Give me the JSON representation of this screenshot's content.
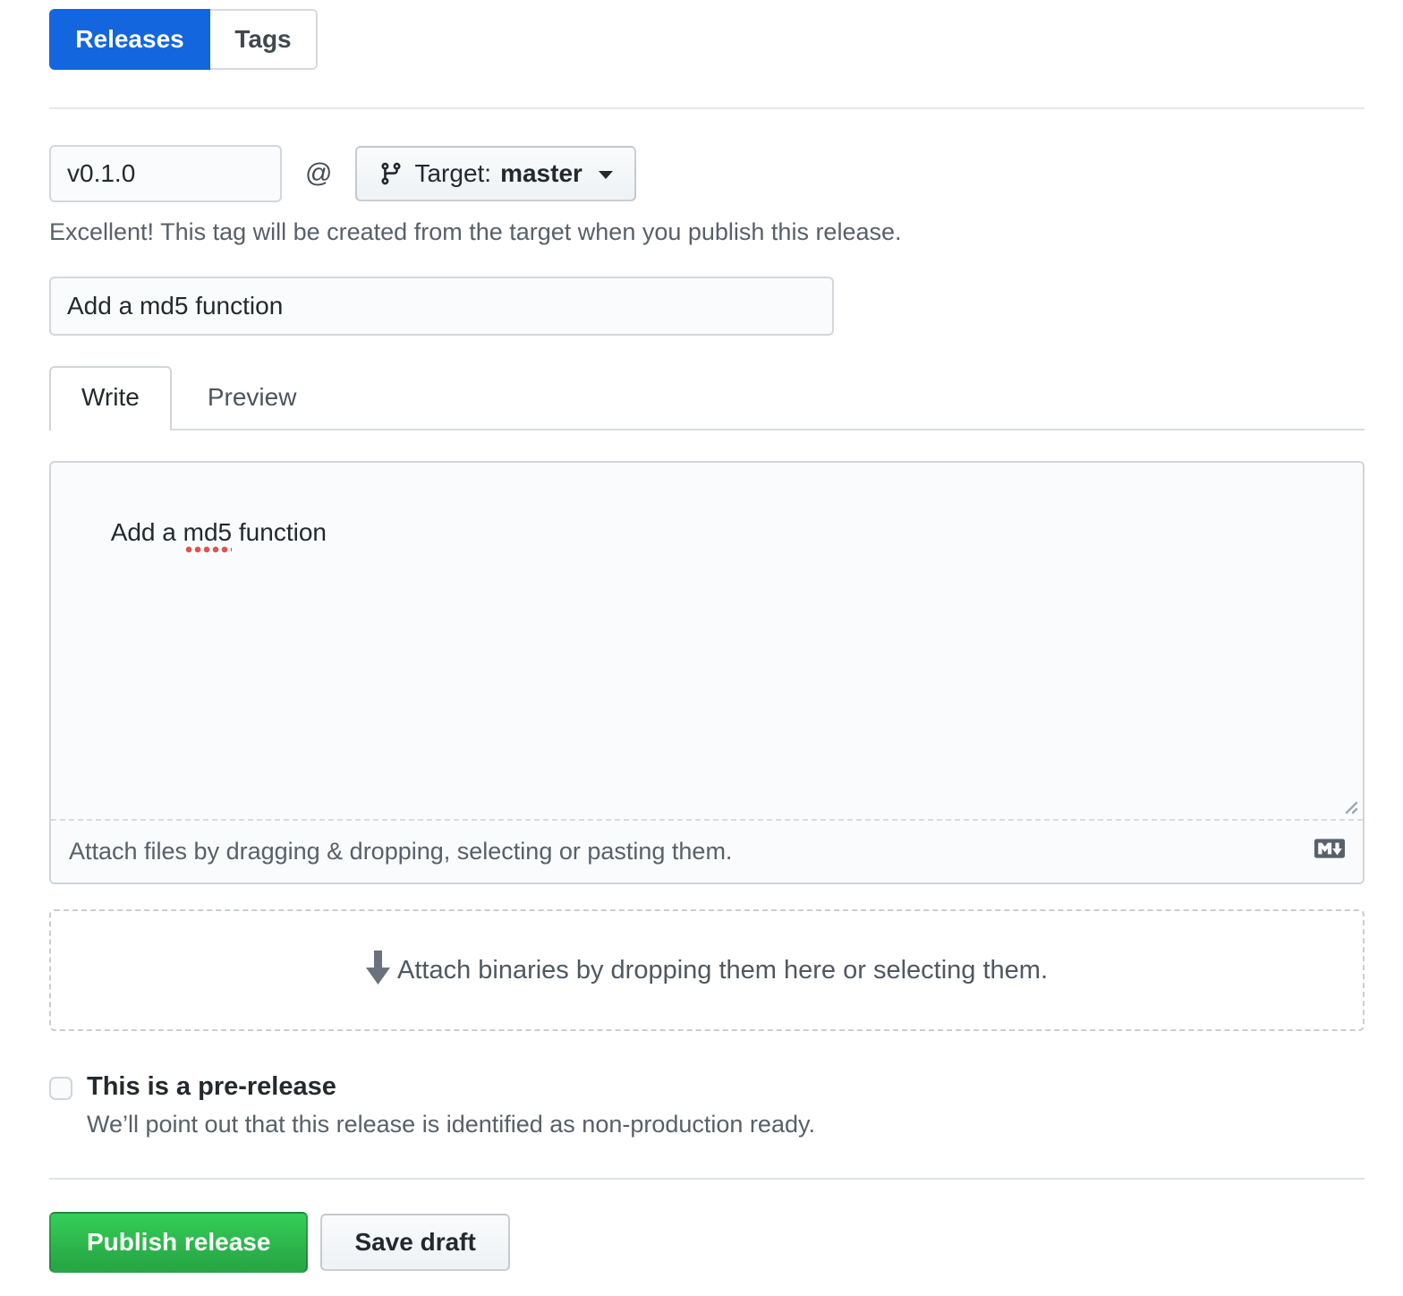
{
  "subnav": {
    "releases_label": "Releases",
    "tags_label": "Tags"
  },
  "tag_section": {
    "tag_input_value": "v0.1.0",
    "at_separator": "@",
    "target_label": "Target:",
    "target_branch": "master",
    "helper_text": "Excellent! This tag will be created from the target when you publish this release."
  },
  "title_section": {
    "title_input_value": "Add a md5 function"
  },
  "editor": {
    "tabs": [
      {
        "label": "Write",
        "active": true
      },
      {
        "label": "Preview",
        "active": false
      }
    ],
    "body_text_before": "Add a ",
    "body_text_misspelled": "md5",
    "body_text_after": " function",
    "attach_hint": "Attach files by dragging & dropping, selecting or pasting them."
  },
  "binaries_dropzone": {
    "hint": "Attach binaries by dropping them here or selecting them."
  },
  "prerelease": {
    "checked": false,
    "label": "This is a pre-release",
    "description": "We’ll point out that this release is identified as non-production ready."
  },
  "actions": {
    "publish_label": "Publish release",
    "save_draft_label": "Save draft"
  },
  "icons": {
    "branch": "git-branch-icon",
    "caret": "caret-down-icon",
    "markdown": "markdown-icon",
    "attach_arrow": "down-arrow-icon",
    "resize": "resize-handle-icon"
  },
  "colors": {
    "accent-blue": "#1366de",
    "publish-green-top": "#34ce57",
    "publish-green-bottom": "#28a745",
    "spellcheck-red": "#e0524e"
  }
}
